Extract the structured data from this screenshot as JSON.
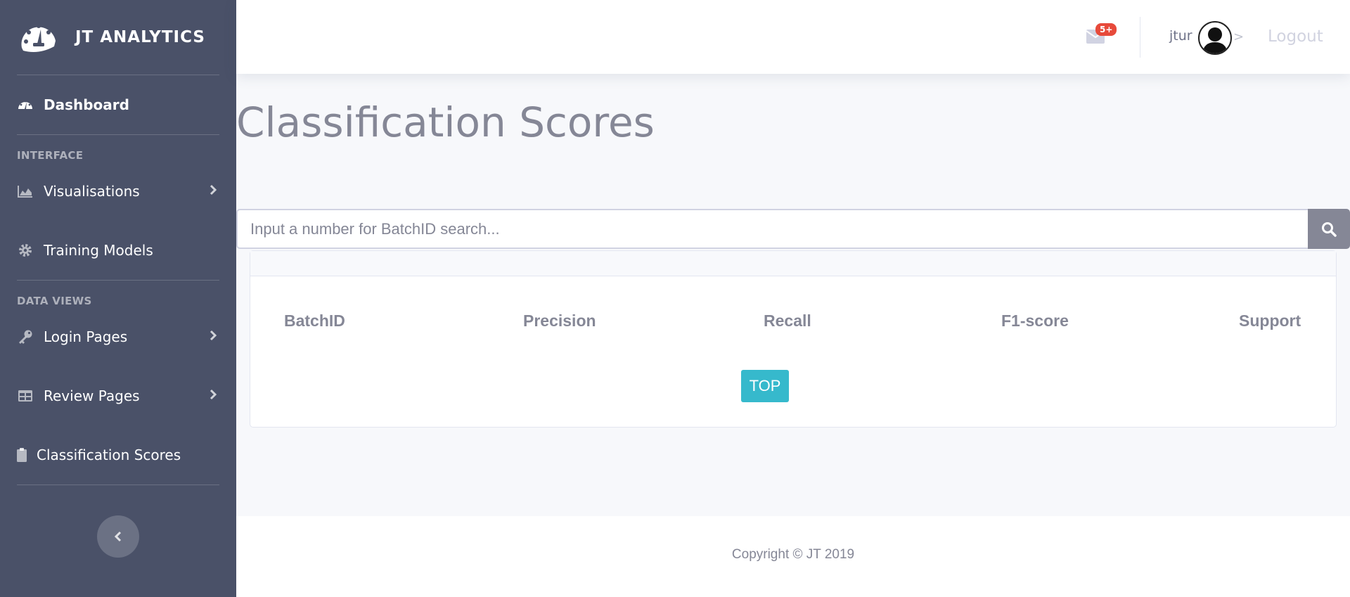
{
  "brand": {
    "name": "JT ANALYTICS"
  },
  "sidebar": {
    "dashboard": "Dashboard",
    "section_interface": "INTERFACE",
    "visualisations": "Visualisations",
    "training_models": "Training Models",
    "section_data_views": "DATA VIEWS",
    "login_pages": "Login Pages",
    "review_pages": "Review Pages",
    "classification_scores": "Classification Scores"
  },
  "topbar": {
    "mail_badge": "5+",
    "username": "jtur",
    "gt": ">",
    "logout": "Logout"
  },
  "main": {
    "title": "Classification Scores",
    "search_placeholder": "Input a number for BatchID search...",
    "table_headers": [
      "BatchID",
      "Precision",
      "Recall",
      "F1-score",
      "Support"
    ],
    "top_button": "TOP"
  },
  "footer": {
    "copyright": "Copyright © JT 2019"
  },
  "colors": {
    "sidebar": "#4a5168",
    "accent_teal": "#36b9cc",
    "badge_red": "#e74a3b",
    "muted_text": "#858796"
  }
}
